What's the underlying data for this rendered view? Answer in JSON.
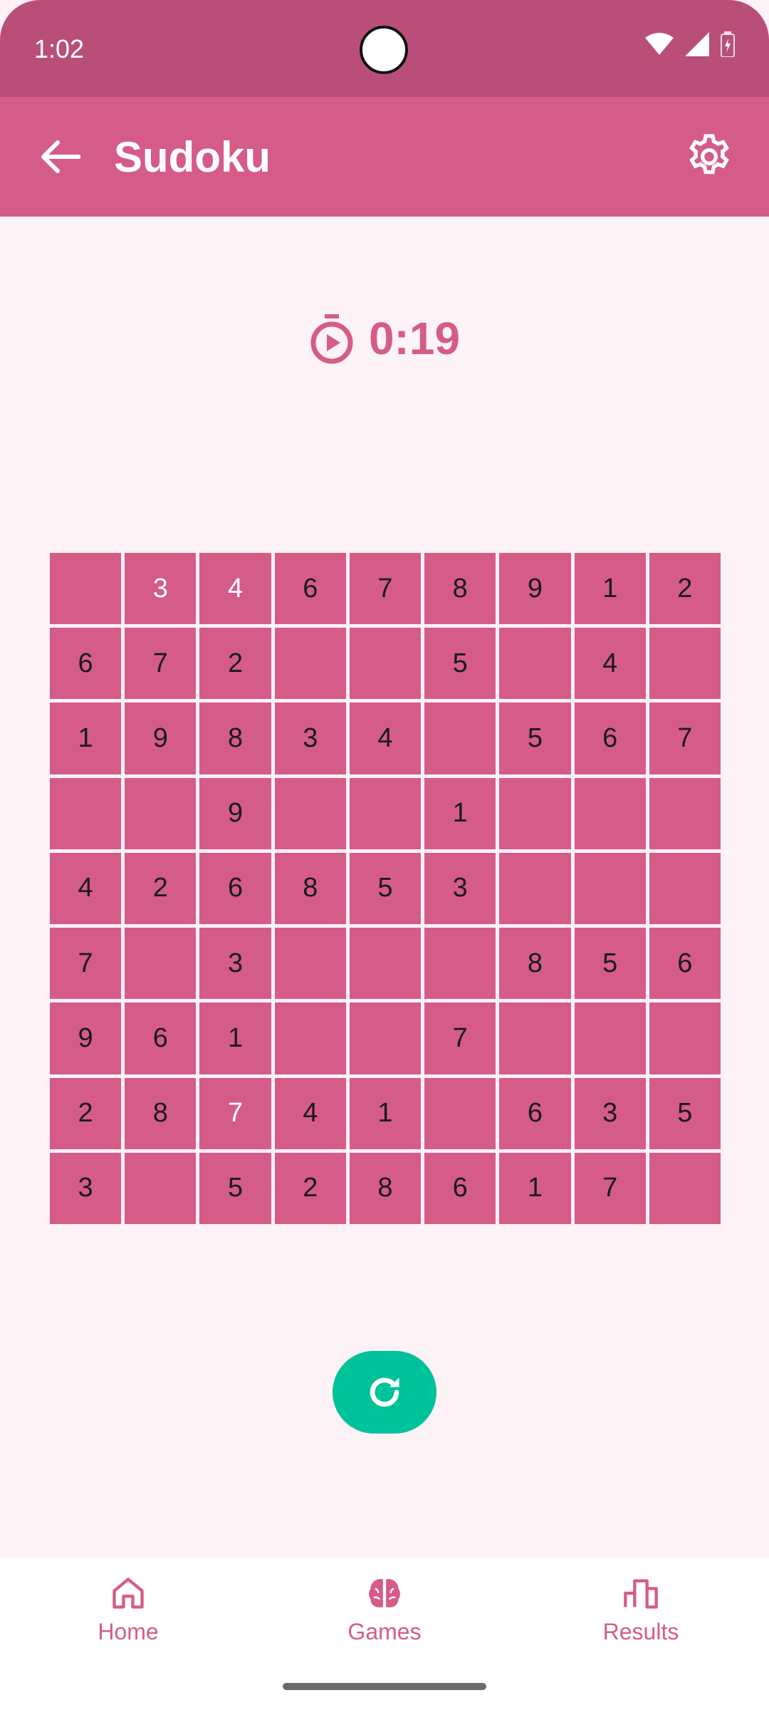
{
  "status": {
    "time": "1:02"
  },
  "appbar": {
    "title": "Sudoku"
  },
  "timer": {
    "value": "0:19"
  },
  "grid": [
    [
      "",
      "3",
      "4",
      "6",
      "7",
      "8",
      "9",
      "1",
      "2"
    ],
    [
      "6",
      "7",
      "2",
      "",
      "",
      "5",
      "",
      "4",
      ""
    ],
    [
      "1",
      "9",
      "8",
      "3",
      "4",
      "",
      "5",
      "6",
      "7"
    ],
    [
      "",
      "",
      "9",
      "",
      "",
      "1",
      "",
      "",
      ""
    ],
    [
      "4",
      "2",
      "6",
      "8",
      "5",
      "3",
      "",
      "",
      ""
    ],
    [
      "7",
      "",
      "3",
      "",
      "",
      "",
      "8",
      "5",
      "6"
    ],
    [
      "9",
      "6",
      "1",
      "",
      "",
      "7",
      "",
      "",
      ""
    ],
    [
      "2",
      "8",
      "7",
      "4",
      "1",
      "",
      "6",
      "3",
      "5"
    ],
    [
      "3",
      "",
      "5",
      "2",
      "8",
      "6",
      "1",
      "7",
      ""
    ]
  ],
  "white_cells": [
    [
      0,
      1
    ],
    [
      0,
      2
    ],
    [
      7,
      2
    ]
  ],
  "nav": {
    "home": "Home",
    "games": "Games",
    "results": "Results"
  },
  "colors": {
    "primary": "#d55c88",
    "status_bar": "#b94f78",
    "fab": "#00c29a",
    "background": "#fdf2f5"
  }
}
